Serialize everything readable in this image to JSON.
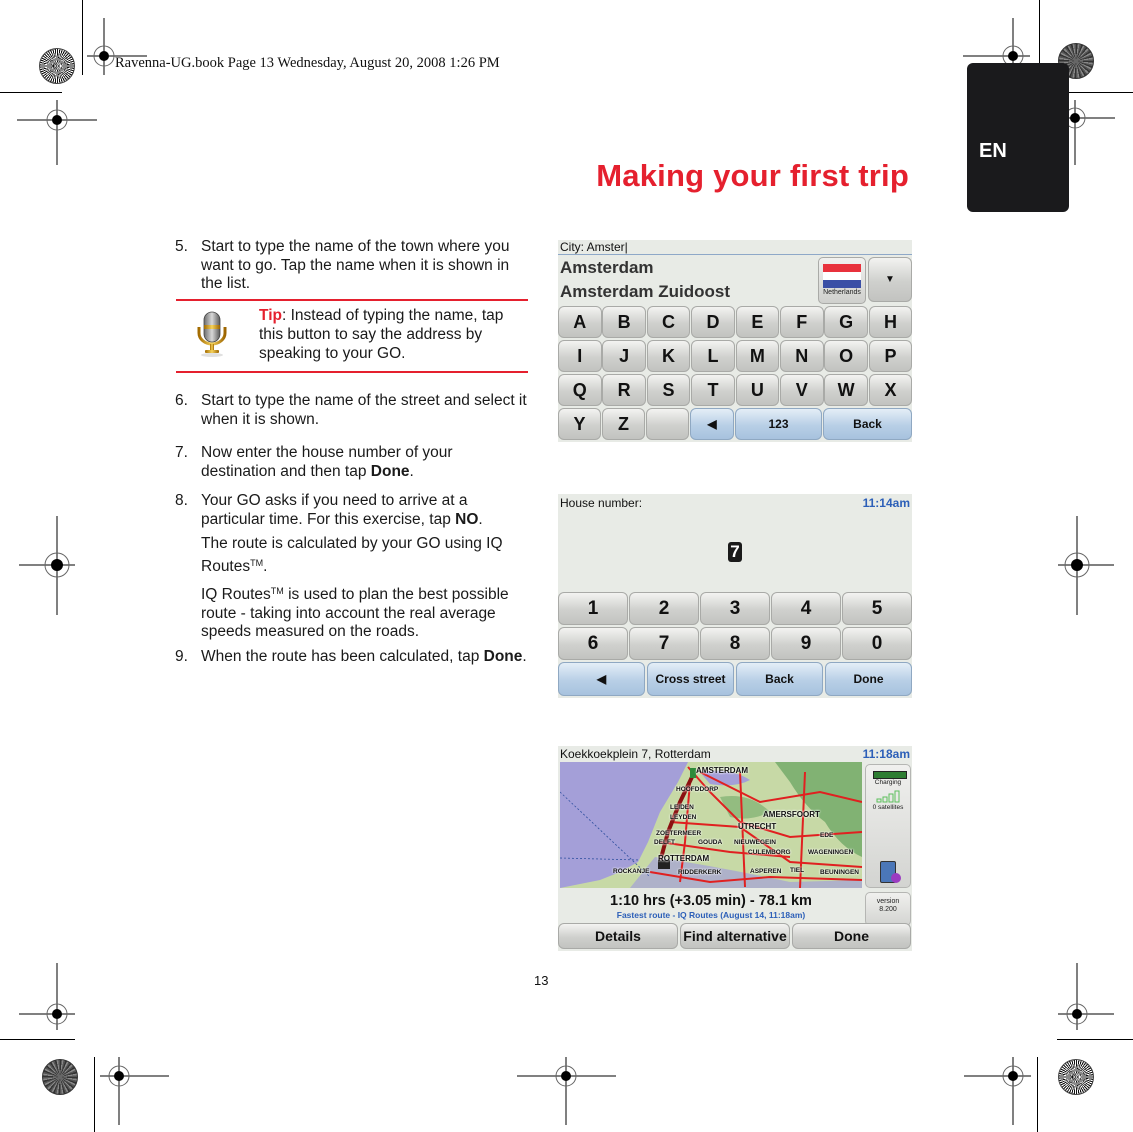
{
  "slug": "Ravenna-UG.book  Page 13  Wednesday, August 20, 2008  1:26 PM",
  "language_tab": "EN",
  "page_title": "Making your first trip",
  "page_number": "13",
  "colors": {
    "accent_red": "#e5202e",
    "tab_dark": "#1a1a1c",
    "clock_blue": "#2c5fb8"
  },
  "steps": [
    {
      "num": "5.",
      "text": "Start to type the name of the town where you want to go. Tap the name when it is shown in the list."
    },
    {
      "num": "6.",
      "text": "Start to type the name of the street and select it when it is shown."
    },
    {
      "num": "7.",
      "text_before": "Now enter the house number of your destination and then tap ",
      "bold": "Done",
      "text_after": "."
    },
    {
      "num": "8.",
      "text_before": "Your GO asks if you need to arrive at a particular time. For this exercise, tap ",
      "bold": "NO",
      "text_after": ".",
      "para2_before": "The route is calculated by your GO using IQ Routes",
      "para2_tm": "TM",
      "para2_after": ".",
      "para3_before": "IQ Routes",
      "para3_tm": "TM",
      "para3_after": " is used to plan the best possible route - taking into account the real average speeds measured on the roads."
    },
    {
      "num": "9.",
      "text_before": "When the route has been calculated, tap ",
      "bold": "Done",
      "text_after": "."
    }
  ],
  "tip": {
    "label": "Tip",
    "text": ": Instead of typing the name, tap this button to say the address by speaking to your GO.",
    "icon": "microphone-icon"
  },
  "screen_city": {
    "input_label": "City: Amster|",
    "results": [
      "Amsterdam",
      "Amsterdam Zuidoost"
    ],
    "country_button": "Netherlands",
    "dropdown_icon": "chevron-down-icon",
    "keys": [
      [
        "A",
        "B",
        "C",
        "D",
        "E",
        "F",
        "G",
        "H"
      ],
      [
        "I",
        "J",
        "K",
        "L",
        "M",
        "N",
        "O",
        "P"
      ],
      [
        "Q",
        "R",
        "S",
        "T",
        "U",
        "V",
        "W",
        "X"
      ]
    ],
    "bottom_keys": [
      "Y",
      "Z"
    ],
    "backspace_icon": "left-arrow-icon",
    "numbers_label": "123",
    "back_label": "Back"
  },
  "screen_house": {
    "label": "House number:",
    "clock": "11:14am",
    "entered_value": "7",
    "keys": [
      [
        "1",
        "2",
        "3",
        "4",
        "5"
      ],
      [
        "6",
        "7",
        "8",
        "9",
        "0"
      ]
    ],
    "backspace_icon": "left-arrow-icon",
    "cross_street_label": "Cross street",
    "back_label": "Back",
    "done_label": "Done"
  },
  "screen_route": {
    "destination": "Koekkoekplein 7, Rotterdam",
    "clock": "11:18am",
    "map_labels": [
      "AMSTERDAM",
      "HOOFDDORP",
      "LEIDEN",
      "LEYDEN",
      "AMERSFOORT",
      "UTRECHT",
      "ZOETERMEER",
      "DELFT",
      "GOUDA",
      "NIEUWEGEIN",
      "EDE",
      "ROTTERDAM",
      "CULEMBORG",
      "WAGENINGEN",
      "ROCKANJE",
      "RIDDERKERK",
      "ASPEREN",
      "TIEL",
      "BEUNINGEN"
    ],
    "battery_label": "Charging",
    "satellites_label": "0 satellites",
    "version_label": "version",
    "version_number": "8.200",
    "summary": "1:10 hrs (+3.05 min) - 78.1 km",
    "route_type": "Fastest route - IQ Routes (August 14, 11:18am)",
    "details_label": "Details",
    "find_alternative_label": "Find alternative",
    "done_label": "Done"
  }
}
